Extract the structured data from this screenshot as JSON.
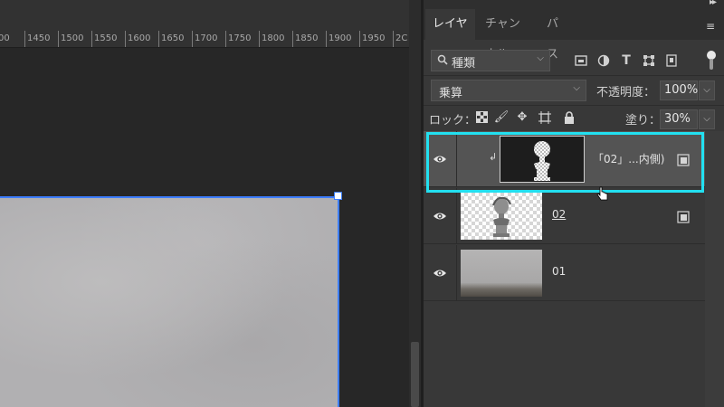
{
  "ruler": {
    "ticks": [
      "00",
      "1450",
      "1500",
      "1550",
      "1600",
      "1650",
      "1700",
      "1750",
      "1800",
      "1850",
      "1900",
      "1950",
      "2C"
    ]
  },
  "panel": {
    "collapse_icon": "double-chevron-right-icon",
    "tabs": [
      "レイヤー",
      "チャンネル",
      "パス"
    ],
    "active_tab": "レイヤー",
    "menu_icon": "panel-menu-icon",
    "filter": {
      "kind_label": "種類",
      "icons": [
        "image-filter-icon",
        "adjustment-filter-icon",
        "type-filter-icon",
        "shape-filter-icon",
        "smart-object-filter-icon"
      ]
    },
    "blend_mode": "乗算",
    "opacity_label": "不透明度：",
    "opacity_value": "100%",
    "lock_label": "ロック：",
    "lock_icons": [
      "lock-transparent-pixels-icon",
      "lock-image-pixels-icon",
      "lock-position-icon",
      "lock-artboard-icon",
      "lock-all-icon"
    ],
    "fill_label": "塗り：",
    "fill_value": "30%"
  },
  "layers": [
    {
      "name": "「02」...内側)",
      "thumbnail": "mask",
      "clipped": true,
      "selected": true,
      "visible": true,
      "smart_object": true
    },
    {
      "name": "02",
      "thumbnail": "transparent-statue",
      "clipped": false,
      "selected": false,
      "visible": true,
      "smart_object": true
    },
    {
      "name": "01",
      "thumbnail": "gray-wall-photo",
      "clipped": false,
      "selected": false,
      "visible": true,
      "smart_object": false
    }
  ],
  "colors": {
    "selection_highlight": "#22e0f0",
    "bounding_box": "#3d7dff",
    "panel_bg": "#383838",
    "selected_row": "#545454"
  }
}
